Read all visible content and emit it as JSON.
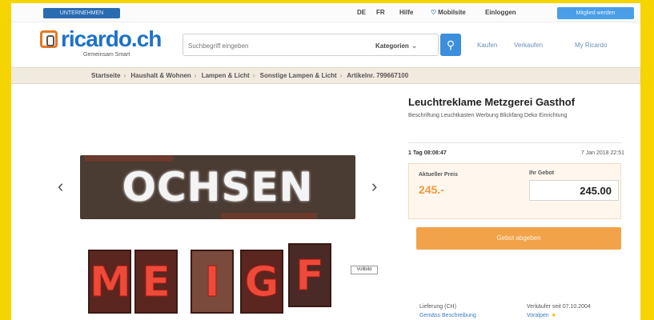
{
  "topbar": {
    "corporate_label": "UNTERNEHMEN",
    "lang_de": "DE",
    "lang_fr": "FR",
    "help": "Hilfe",
    "mobile": "Mobilsite",
    "login": "Einloggen",
    "signup": "Mitglied werden"
  },
  "header": {
    "logo": "ricardo.ch",
    "tagline": "Gemeinsam Smart",
    "search_placeholder": "Suchbegriff eingeben",
    "category_select": "Kategorien",
    "nav_sell": "Kaufen",
    "nav_buy": "Verkaufen",
    "nav_my": "My Ricardo"
  },
  "breadcrumb": [
    "Startseite",
    "Haushalt & Wohnen",
    "Lampen & Licht",
    "Sonstige Lampen & Licht",
    "Artikelnr. 799667100"
  ],
  "product": {
    "title": "Leuchtreklame Metzgerei Gasthof",
    "subtitle": "Beschriftung Leuchtkasten Werbung Blickfang Deko Einrichtung",
    "sign_top_text": "OCHSEN",
    "tiles": [
      "M",
      "E",
      "I",
      "G",
      "F"
    ],
    "zoom_label": "Vollbild",
    "remaining": "1 Tag 08:08:47",
    "end_date": "7 Jan 2018 22:51",
    "current_price_label": "Aktueller Preis",
    "current_price": "245.-",
    "bid_label": "Ihr Gebot",
    "bid_value": "245.00",
    "bid_button": "Gebot abgeben",
    "shipping_label": "Lieferung (CH)",
    "shipping_value": "Gemäss Beschreibung",
    "seller_label": "Verkäufer seit 07.10.2004",
    "seller_value": "Voralpen"
  }
}
